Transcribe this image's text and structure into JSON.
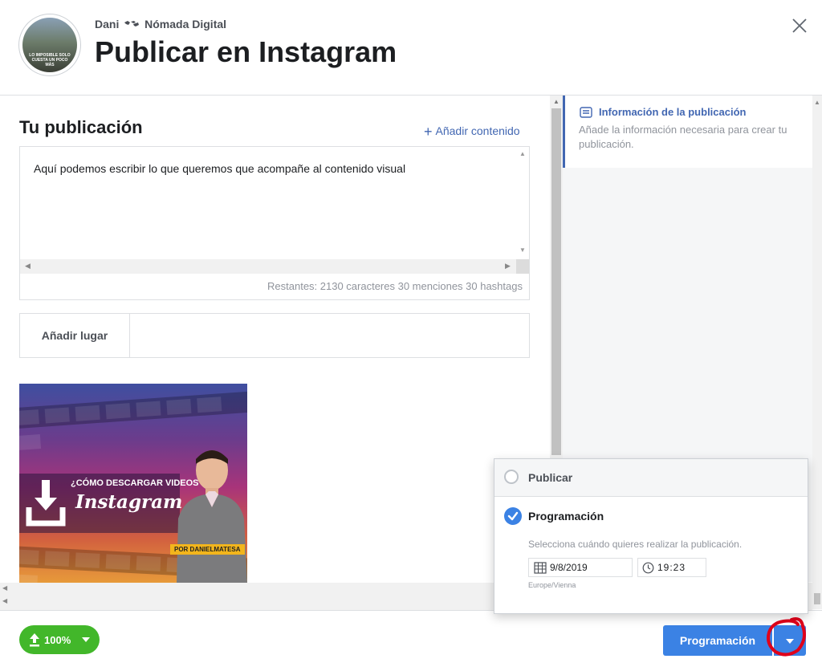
{
  "header": {
    "account_prefix": "Dani",
    "account_suffix": "Nómada Digital",
    "title": "Publicar en Instagram",
    "avatar_text": "LO IMPOSIBLE SOLO CUESTA UN POCO MÁS"
  },
  "composer": {
    "section_title": "Tu publicación",
    "add_content_label": "Añadir contenido",
    "post_text": "Aquí podemos escribir lo que queremos que acompañe al contenido visual",
    "counter": "Restantes: 2130 caracteres 30 menciones 30 hashtags",
    "place_label": "Añadir lugar"
  },
  "media": {
    "line1": "¿CÓMO DESCARGAR VIDEOS EN",
    "line2": "Instagram",
    "credit": "POR DANIELMATESA"
  },
  "info_panel": {
    "title": "Información de la publicación",
    "description": "Añade la información necesaria para crear tu publicación."
  },
  "publish_popup": {
    "option_publish": "Publicar",
    "option_schedule": "Programación",
    "selected": "Programación",
    "help_text": "Selecciona cuándo quieres realizar la publicación.",
    "date_value": "9/8/2019",
    "time_value": "19:23",
    "timezone": "Europe/Vienna"
  },
  "footer": {
    "upload_progress": "100%",
    "primary_button": "Programación"
  },
  "colors": {
    "brand_blue": "#4267b2",
    "button_blue": "#3b82e4",
    "upload_green": "#42b72a",
    "annotation_red": "#e0001a"
  },
  "icons": {
    "close": "close-icon",
    "add": "plus-icon",
    "info": "post-info-icon",
    "calendar": "calendar-icon",
    "clock": "clock-icon",
    "upload": "upload-arrow-icon",
    "dropdown": "chevron-down-icon",
    "map": "world-map-icon"
  }
}
